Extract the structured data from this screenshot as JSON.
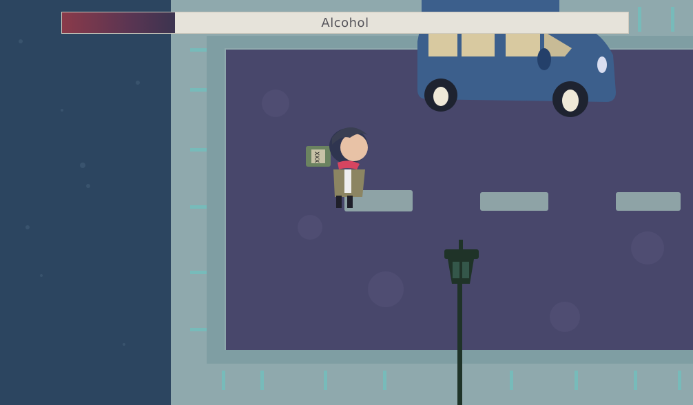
{
  "hud": {
    "meter_label": "Alcohol",
    "meter_level": 0.2,
    "meter_color": "#7a3548"
  },
  "scene": {
    "colors": {
      "water": "#2c4560",
      "sidewalk": "#8fa9ad",
      "road": "#48476b",
      "lane_marking": "#8ea3a6",
      "car": "#3c5f8c",
      "lamp": "#1f3328"
    },
    "props": [
      "parked-van",
      "street-lamp",
      "lane-markings",
      "character-holding-bottle"
    ],
    "bottle_label": "XXX"
  }
}
